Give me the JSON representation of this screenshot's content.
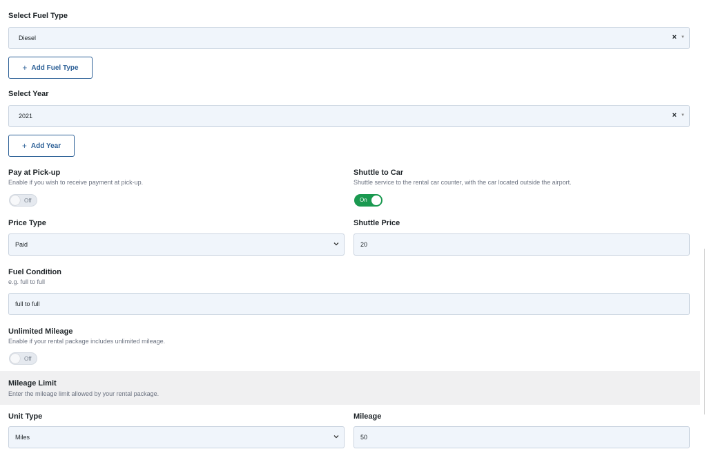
{
  "fuel_type": {
    "label": "Select Fuel Type",
    "selected": "Diesel",
    "clear_symbol": "×",
    "add_button": {
      "icon": "+",
      "label": "Add Fuel Type"
    }
  },
  "year": {
    "label": "Select Year",
    "selected": "2021",
    "clear_symbol": "×",
    "add_button": {
      "icon": "+",
      "label": "Add Year"
    }
  },
  "pay_at_pickup": {
    "label": "Pay at Pick-up",
    "description": "Enable if you wish to receive payment at pick-up.",
    "toggle_text": "Off",
    "enabled": false
  },
  "shuttle_to_car": {
    "label": "Shuttle to Car",
    "description": "Shuttle service to the rental car counter, with the car located outside the airport.",
    "toggle_text": "On",
    "enabled": true
  },
  "price_type": {
    "label": "Price Type",
    "selected": "Paid"
  },
  "shuttle_price": {
    "label": "Shuttle Price",
    "value": "20"
  },
  "fuel_condition": {
    "label": "Fuel Condition",
    "description": "e.g. full to full",
    "value": "full to full"
  },
  "unlimited_mileage": {
    "label": "Unlimited Mileage",
    "description": "Enable if your rental package includes unlimited mileage.",
    "toggle_text": "Off",
    "enabled": false
  },
  "mileage_limit": {
    "label": "Mileage Limit",
    "description": "Enter the mileage limit allowed by your rental package."
  },
  "unit_type": {
    "label": "Unit Type",
    "selected": "Miles"
  },
  "mileage": {
    "label": "Mileage",
    "value": "50"
  },
  "colors": {
    "accent_blue": "#2b5f96",
    "toggle_on": "#1a9950",
    "field_bg": "#f0f5fb"
  }
}
